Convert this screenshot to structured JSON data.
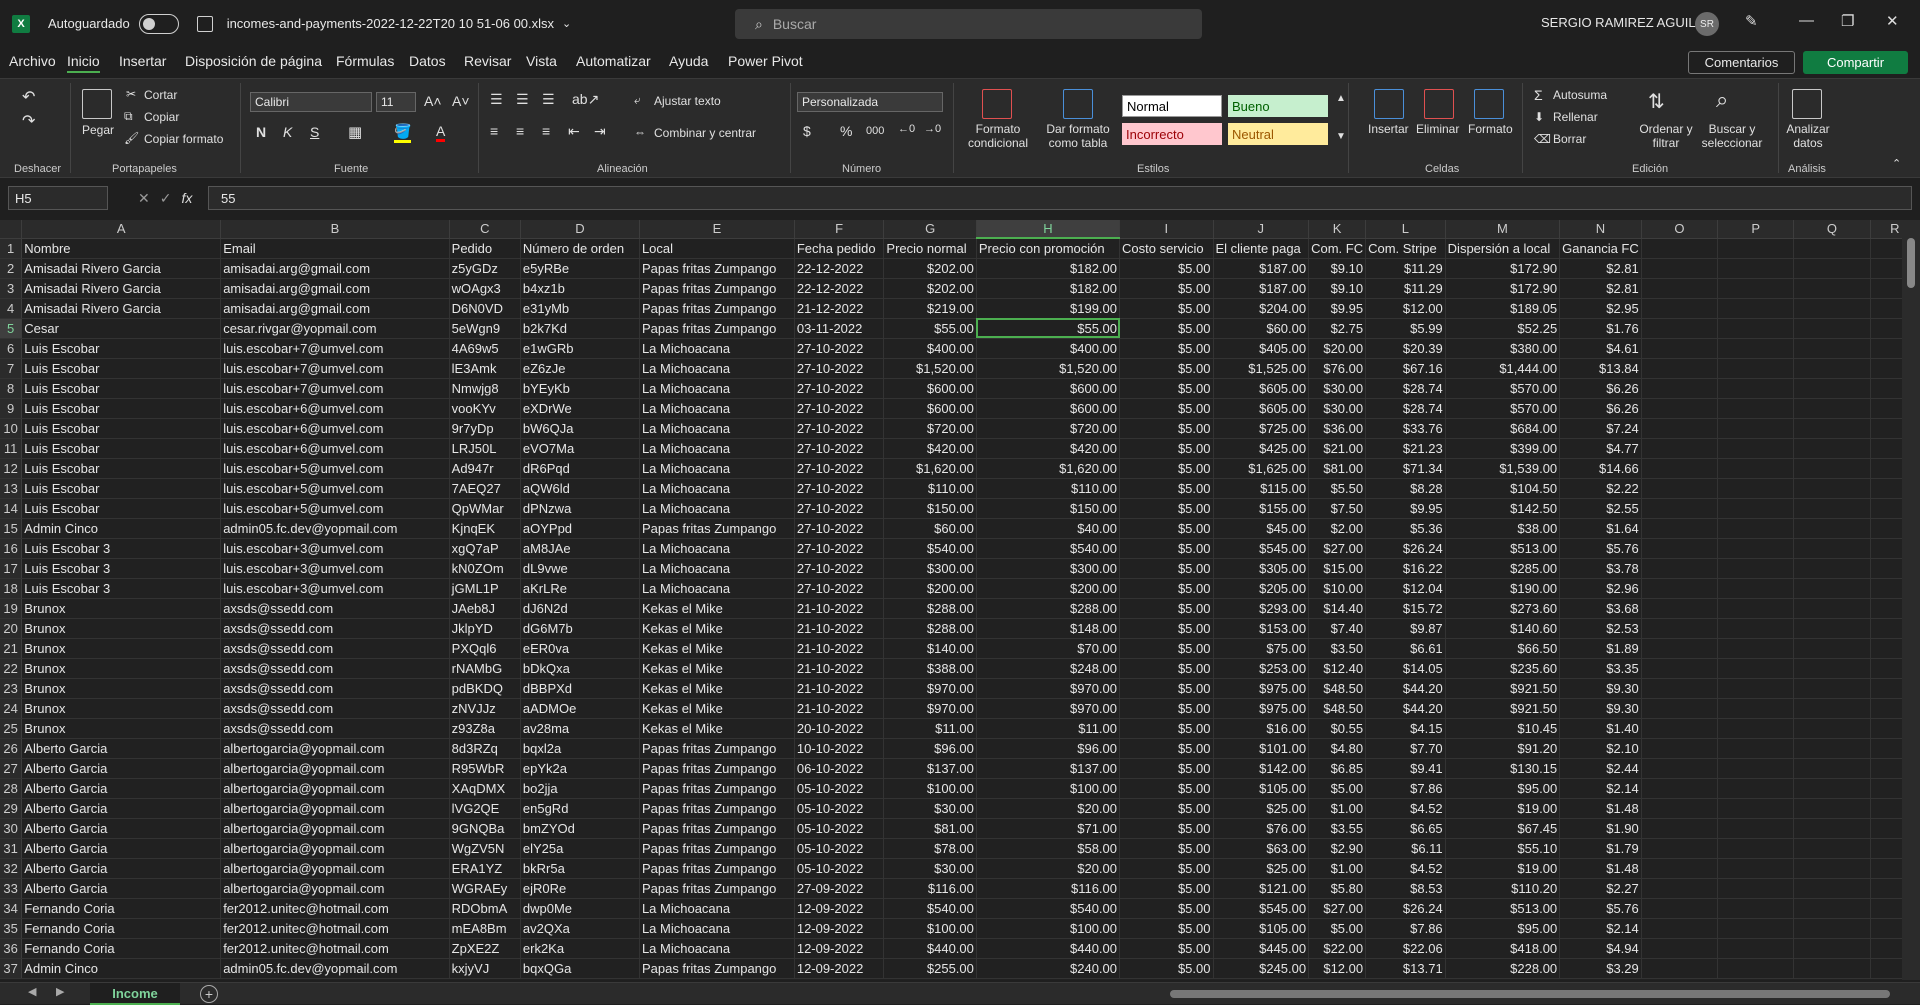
{
  "titlebar": {
    "autosave_label": "Autoguardado",
    "filename": "incomes-and-payments-2022-12-22T20 10 51-06 00.xlsx",
    "search_placeholder": "Buscar",
    "user_name": "SERGIO RAMIREZ AGUILAR",
    "user_initials": "SR"
  },
  "menu": [
    "Archivo",
    "Inicio",
    "Insertar",
    "Disposición de página",
    "Fórmulas",
    "Datos",
    "Revisar",
    "Vista",
    "Automatizar",
    "Ayuda",
    "Power Pivot"
  ],
  "menu_active": "Inicio",
  "actions": {
    "comments": "Comentarios",
    "share": "Compartir"
  },
  "ribbon": {
    "undo_group": "Deshacer",
    "clipboard": {
      "paste": "Pegar",
      "cut": "Cortar",
      "copy": "Copiar",
      "format_painter": "Copiar formato",
      "label": "Portapapeles"
    },
    "font": {
      "name": "Calibri",
      "size": "11",
      "bold": "N",
      "italic": "K",
      "underline": "S",
      "label": "Fuente"
    },
    "alignment": {
      "wrap": "Ajustar texto",
      "merge": "Combinar y centrar",
      "label": "Alineación"
    },
    "number": {
      "format": "Personalizada",
      "label": "Número"
    },
    "styles": {
      "cond_format": "Formato condicional",
      "table_format": "Dar formato como tabla",
      "normal": "Normal",
      "good": "Bueno",
      "bad": "Incorrecto",
      "neutral": "Neutral",
      "label": "Estilos"
    },
    "cells": {
      "insert": "Insertar",
      "delete": "Eliminar",
      "format": "Formato",
      "label": "Celdas"
    },
    "editing": {
      "autosum": "Autosuma",
      "fill": "Rellenar",
      "clear": "Borrar",
      "sort": "Ordenar y filtrar",
      "find": "Buscar y seleccionar",
      "label": "Edición"
    },
    "analysis": {
      "analyze": "Analizar datos",
      "label": "Análisis"
    }
  },
  "formula_bar": {
    "cell_ref": "H5",
    "value": "55"
  },
  "columns": [
    "A",
    "B",
    "C",
    "D",
    "E",
    "F",
    "G",
    "H",
    "I",
    "J",
    "K",
    "L",
    "M",
    "N",
    "O",
    "P",
    "Q",
    "R"
  ],
  "selected_column": "H",
  "selected_row": 5,
  "header": [
    "Nombre",
    "Email",
    "Pedido",
    "Número de orden",
    "Local",
    "Fecha pedido",
    "Precio normal",
    "Precio con promoción",
    "Costo servicio",
    "El cliente paga",
    "Com. FC",
    "Com. Stripe",
    "Dispersión a local",
    "Ganancia FC"
  ],
  "rows": [
    [
      "Amisadai Rivero Garcia",
      "amisadai.arg@gmail.com",
      "z5yGDz",
      "e5yRBe",
      "Papas fritas Zumpango",
      "22-12-2022",
      "$202.00",
      "$182.00",
      "$5.00",
      "$187.00",
      "$9.10",
      "$11.29",
      "$172.90",
      "$2.81"
    ],
    [
      "Amisadai Rivero Garcia",
      "amisadai.arg@gmail.com",
      "wOAgx3",
      "b4xz1b",
      "Papas fritas Zumpango",
      "22-12-2022",
      "$202.00",
      "$182.00",
      "$5.00",
      "$187.00",
      "$9.10",
      "$11.29",
      "$172.90",
      "$2.81"
    ],
    [
      "Amisadai Rivero Garcia",
      "amisadai.arg@gmail.com",
      "D6N0VD",
      "e31yMb",
      "Papas fritas Zumpango",
      "21-12-2022",
      "$219.00",
      "$199.00",
      "$5.00",
      "$204.00",
      "$9.95",
      "$12.00",
      "$189.05",
      "$2.95"
    ],
    [
      "Cesar",
      "cesar.rivgar@yopmail.com",
      "5eWgn9",
      "b2k7Kd",
      "Papas fritas Zumpango",
      "03-11-2022",
      "$55.00",
      "$55.00",
      "$5.00",
      "$60.00",
      "$2.75",
      "$5.99",
      "$52.25",
      "$1.76"
    ],
    [
      "Luis Escobar",
      "luis.escobar+7@umvel.com",
      "4A69w5",
      "e1wGRb",
      "La Michoacana",
      "27-10-2022",
      "$400.00",
      "$400.00",
      "$5.00",
      "$405.00",
      "$20.00",
      "$20.39",
      "$380.00",
      "$4.61"
    ],
    [
      "Luis Escobar",
      "luis.escobar+7@umvel.com",
      "lE3Amk",
      "eZ6zJe",
      "La Michoacana",
      "27-10-2022",
      "$1,520.00",
      "$1,520.00",
      "$5.00",
      "$1,525.00",
      "$76.00",
      "$67.16",
      "$1,444.00",
      "$13.84"
    ],
    [
      "Luis Escobar",
      "luis.escobar+7@umvel.com",
      "Nmwjg8",
      "bYEyKb",
      "La Michoacana",
      "27-10-2022",
      "$600.00",
      "$600.00",
      "$5.00",
      "$605.00",
      "$30.00",
      "$28.74",
      "$570.00",
      "$6.26"
    ],
    [
      "Luis Escobar",
      "luis.escobar+6@umvel.com",
      "vooKYv",
      "eXDrWe",
      "La Michoacana",
      "27-10-2022",
      "$600.00",
      "$600.00",
      "$5.00",
      "$605.00",
      "$30.00",
      "$28.74",
      "$570.00",
      "$6.26"
    ],
    [
      "Luis Escobar",
      "luis.escobar+6@umvel.com",
      "9r7yDp",
      "bW6QJa",
      "La Michoacana",
      "27-10-2022",
      "$720.00",
      "$720.00",
      "$5.00",
      "$725.00",
      "$36.00",
      "$33.76",
      "$684.00",
      "$7.24"
    ],
    [
      "Luis Escobar",
      "luis.escobar+6@umvel.com",
      "LRJ50L",
      "eVO7Ma",
      "La Michoacana",
      "27-10-2022",
      "$420.00",
      "$420.00",
      "$5.00",
      "$425.00",
      "$21.00",
      "$21.23",
      "$399.00",
      "$4.77"
    ],
    [
      "Luis Escobar",
      "luis.escobar+5@umvel.com",
      "Ad947r",
      "dR6Pqd",
      "La Michoacana",
      "27-10-2022",
      "$1,620.00",
      "$1,620.00",
      "$5.00",
      "$1,625.00",
      "$81.00",
      "$71.34",
      "$1,539.00",
      "$14.66"
    ],
    [
      "Luis Escobar",
      "luis.escobar+5@umvel.com",
      "7AEQ27",
      "aQW6ld",
      "La Michoacana",
      "27-10-2022",
      "$110.00",
      "$110.00",
      "$5.00",
      "$115.00",
      "$5.50",
      "$8.28",
      "$104.50",
      "$2.22"
    ],
    [
      "Luis Escobar",
      "luis.escobar+5@umvel.com",
      "QpWMar",
      "dPNzwa",
      "La Michoacana",
      "27-10-2022",
      "$150.00",
      "$150.00",
      "$5.00",
      "$155.00",
      "$7.50",
      "$9.95",
      "$142.50",
      "$2.55"
    ],
    [
      "Admin Cinco",
      "admin05.fc.dev@yopmail.com",
      "KjnqEK",
      "aOYPpd",
      "Papas fritas Zumpango",
      "27-10-2022",
      "$60.00",
      "$40.00",
      "$5.00",
      "$45.00",
      "$2.00",
      "$5.36",
      "$38.00",
      "$1.64"
    ],
    [
      "Luis Escobar  3",
      "luis.escobar+3@umvel.com",
      "xgQ7aP",
      "aM8JAe",
      "La Michoacana",
      "27-10-2022",
      "$540.00",
      "$540.00",
      "$5.00",
      "$545.00",
      "$27.00",
      "$26.24",
      "$513.00",
      "$5.76"
    ],
    [
      "Luis Escobar  3",
      "luis.escobar+3@umvel.com",
      "kN0ZOm",
      "dL9vwe",
      "La Michoacana",
      "27-10-2022",
      "$300.00",
      "$300.00",
      "$5.00",
      "$305.00",
      "$15.00",
      "$16.22",
      "$285.00",
      "$3.78"
    ],
    [
      "Luis Escobar  3",
      "luis.escobar+3@umvel.com",
      "jGML1P",
      "aKrLRe",
      "La Michoacana",
      "27-10-2022",
      "$200.00",
      "$200.00",
      "$5.00",
      "$205.00",
      "$10.00",
      "$12.04",
      "$190.00",
      "$2.96"
    ],
    [
      "Brunox",
      "axsds@ssedd.com",
      "JAeb8J",
      "dJ6N2d",
      "Kekas el Mike",
      "21-10-2022",
      "$288.00",
      "$288.00",
      "$5.00",
      "$293.00",
      "$14.40",
      "$15.72",
      "$273.60",
      "$3.68"
    ],
    [
      "Brunox",
      "axsds@ssedd.com",
      "JklpYD",
      "dG6M7b",
      "Kekas el Mike",
      "21-10-2022",
      "$288.00",
      "$148.00",
      "$5.00",
      "$153.00",
      "$7.40",
      "$9.87",
      "$140.60",
      "$2.53"
    ],
    [
      "Brunox",
      "axsds@ssedd.com",
      "PXQql6",
      "eER0va",
      "Kekas el Mike",
      "21-10-2022",
      "$140.00",
      "$70.00",
      "$5.00",
      "$75.00",
      "$3.50",
      "$6.61",
      "$66.50",
      "$1.89"
    ],
    [
      "Brunox",
      "axsds@ssedd.com",
      "rNAMbG",
      "bDkQxa",
      "Kekas el Mike",
      "21-10-2022",
      "$388.00",
      "$248.00",
      "$5.00",
      "$253.00",
      "$12.40",
      "$14.05",
      "$235.60",
      "$3.35"
    ],
    [
      "Brunox",
      "axsds@ssedd.com",
      "pdBKDQ",
      "dBBPXd",
      "Kekas el Mike",
      "21-10-2022",
      "$970.00",
      "$970.00",
      "$5.00",
      "$975.00",
      "$48.50",
      "$44.20",
      "$921.50",
      "$9.30"
    ],
    [
      "Brunox",
      "axsds@ssedd.com",
      "zNVJJz",
      "aADMOe",
      "Kekas el Mike",
      "21-10-2022",
      "$970.00",
      "$970.00",
      "$5.00",
      "$975.00",
      "$48.50",
      "$44.20",
      "$921.50",
      "$9.30"
    ],
    [
      "Brunox",
      "axsds@ssedd.com",
      "z93Z8a",
      "av28ma",
      "Kekas el Mike",
      "20-10-2022",
      "$11.00",
      "$11.00",
      "$5.00",
      "$16.00",
      "$0.55",
      "$4.15",
      "$10.45",
      "$1.40"
    ],
    [
      "Alberto Garcia",
      "albertogarcia@yopmail.com",
      "8d3RZq",
      "bqxl2a",
      "Papas fritas Zumpango",
      "10-10-2022",
      "$96.00",
      "$96.00",
      "$5.00",
      "$101.00",
      "$4.80",
      "$7.70",
      "$91.20",
      "$2.10"
    ],
    [
      "Alberto Garcia",
      "albertogarcia@yopmail.com",
      "R95WbR",
      "epYk2a",
      "Papas fritas Zumpango",
      "06-10-2022",
      "$137.00",
      "$137.00",
      "$5.00",
      "$142.00",
      "$6.85",
      "$9.41",
      "$130.15",
      "$2.44"
    ],
    [
      "Alberto Garcia",
      "albertogarcia@yopmail.com",
      "XAqDMX",
      "bo2jja",
      "Papas fritas Zumpango",
      "05-10-2022",
      "$100.00",
      "$100.00",
      "$5.00",
      "$105.00",
      "$5.00",
      "$7.86",
      "$95.00",
      "$2.14"
    ],
    [
      "Alberto Garcia",
      "albertogarcia@yopmail.com",
      "lVG2QE",
      "en5gRd",
      "Papas fritas Zumpango",
      "05-10-2022",
      "$30.00",
      "$20.00",
      "$5.00",
      "$25.00",
      "$1.00",
      "$4.52",
      "$19.00",
      "$1.48"
    ],
    [
      "Alberto Garcia",
      "albertogarcia@yopmail.com",
      "9GNQBa",
      "bmZYOd",
      "Papas fritas Zumpango",
      "05-10-2022",
      "$81.00",
      "$71.00",
      "$5.00",
      "$76.00",
      "$3.55",
      "$6.65",
      "$67.45",
      "$1.90"
    ],
    [
      "Alberto Garcia",
      "albertogarcia@yopmail.com",
      "WgZV5N",
      "elY25a",
      "Papas fritas Zumpango",
      "05-10-2022",
      "$78.00",
      "$58.00",
      "$5.00",
      "$63.00",
      "$2.90",
      "$6.11",
      "$55.10",
      "$1.79"
    ],
    [
      "Alberto Garcia",
      "albertogarcia@yopmail.com",
      "ERA1YZ",
      "bkRr5a",
      "Papas fritas Zumpango",
      "05-10-2022",
      "$30.00",
      "$20.00",
      "$5.00",
      "$25.00",
      "$1.00",
      "$4.52",
      "$19.00",
      "$1.48"
    ],
    [
      "Alberto Garcia",
      "albertogarcia@yopmail.com",
      "WGRAEy",
      "ejR0Re",
      "Papas fritas Zumpango",
      "27-09-2022",
      "$116.00",
      "$116.00",
      "$5.00",
      "$121.00",
      "$5.80",
      "$8.53",
      "$110.20",
      "$2.27"
    ],
    [
      "Fernando Coria",
      "fer2012.unitec@hotmail.com",
      "RDObmA",
      "dwp0Me",
      "La Michoacana",
      "12-09-2022",
      "$540.00",
      "$540.00",
      "$5.00",
      "$545.00",
      "$27.00",
      "$26.24",
      "$513.00",
      "$5.76"
    ],
    [
      "Fernando Coria",
      "fer2012.unitec@hotmail.com",
      "mEA8Bm",
      "av2QXa",
      "La Michoacana",
      "12-09-2022",
      "$100.00",
      "$100.00",
      "$5.00",
      "$105.00",
      "$5.00",
      "$7.86",
      "$95.00",
      "$2.14"
    ],
    [
      "Fernando Coria",
      "fer2012.unitec@hotmail.com",
      "ZpXE2Z",
      "erk2Ka",
      "La Michoacana",
      "12-09-2022",
      "$440.00",
      "$440.00",
      "$5.00",
      "$445.00",
      "$22.00",
      "$22.06",
      "$418.00",
      "$4.94"
    ],
    [
      "Admin Cinco",
      "admin05.fc.dev@yopmail.com",
      "kxjyVJ",
      "bqxQGa",
      "Papas fritas Zumpango",
      "12-09-2022",
      "$255.00",
      "$240.00",
      "$5.00",
      "$245.00",
      "$12.00",
      "$13.71",
      "$228.00",
      "$3.29"
    ]
  ],
  "sheet_tab": "Income",
  "colors": {
    "accent": "#107c41",
    "selection": "#4caf50",
    "good_bg": "#c6efce",
    "bad_bg": "#ffc7ce",
    "neutral_bg": "#ffeb9c"
  }
}
